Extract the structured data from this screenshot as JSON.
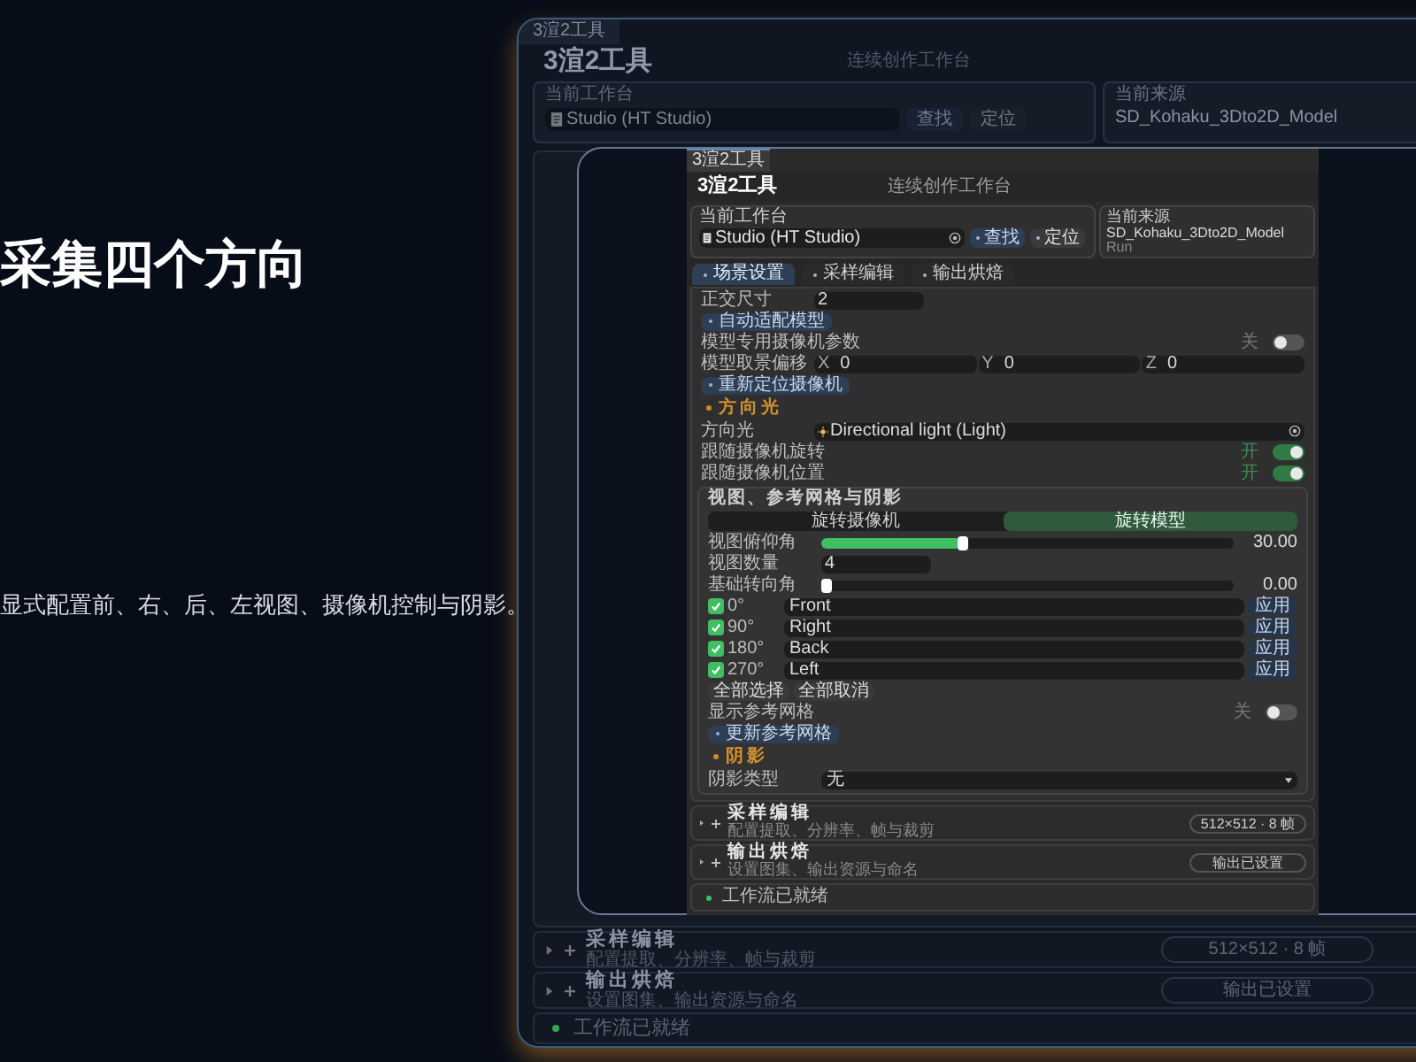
{
  "slide": {
    "heading": "采集四个方向",
    "description": "显式配置前、右、后、左视图、摄像机控制与阴影。"
  },
  "background_window": {
    "tab": "3渲2工具",
    "title": "3渲2工具",
    "subtitle": "连续创作工作台",
    "workspace_label": "当前工作台",
    "workspace_value": "Studio (HT Studio)",
    "find_button": "查找",
    "locate_button": "定位",
    "source_label": "当前来源",
    "source_value": "SD_Kohaku_3Dto2D_Model",
    "sections": [
      {
        "title": "采样编辑",
        "subtitle": "配置提取、分辨率、帧与裁剪",
        "badge": "512×512 · 8 帧"
      },
      {
        "title": "输出烘焙",
        "subtitle": "设置图集、输出资源与命名",
        "badge": "输出已设置"
      }
    ],
    "status": "工作流已就绪"
  },
  "window": {
    "tab": "3渲2工具",
    "title": "3渲2工具",
    "subtitle": "连续创作工作台",
    "workspace_label": "当前工作台",
    "workspace_value": "Studio (HT Studio)",
    "find_button": "查找",
    "locate_button": "定位",
    "source_label": "当前来源",
    "source_value": "SD_Kohaku_3Dto2D_Model",
    "source_note": "Run",
    "tabs": [
      {
        "label": "场景设置",
        "selected": true
      },
      {
        "label": "采样编辑",
        "selected": false
      },
      {
        "label": "输出烘焙",
        "selected": false
      }
    ],
    "scene_rows": [
      {
        "kind": "input",
        "label": "正交尺寸",
        "value": "2"
      },
      {
        "kind": "button",
        "label": "自动适配模型"
      },
      {
        "kind": "toggle",
        "label": "模型专用摄像机参数",
        "state_text": "关",
        "on": false
      },
      {
        "kind": "xyz",
        "label": "模型取景偏移",
        "axes": [
          {
            "axis": "X",
            "value": "0"
          },
          {
            "axis": "Y",
            "value": "0"
          },
          {
            "axis": "Z",
            "value": "0"
          }
        ]
      },
      {
        "kind": "button",
        "label": "重新定位摄像机"
      },
      {
        "kind": "section",
        "label": "方向光"
      },
      {
        "kind": "object",
        "label": "方向光",
        "value": "Directional light (Light)"
      },
      {
        "kind": "toggle",
        "label": "跟随摄像机旋转",
        "state_text": "开",
        "on": true
      },
      {
        "kind": "toggle",
        "label": "跟随摄像机位置",
        "state_text": "开",
        "on": true
      }
    ],
    "views_card": {
      "title": "视图、参考网格与阴影",
      "rows": [
        {
          "kind": "segmented",
          "options": [
            {
              "label": "旋转摄像机",
              "selected": false
            },
            {
              "label": "旋转模型",
              "selected": true
            }
          ]
        },
        {
          "kind": "slider",
          "label": "视图俯仰角",
          "level": 0.34,
          "reading": "30.00"
        },
        {
          "kind": "input",
          "label": "视图数量",
          "value": "4"
        },
        {
          "kind": "slider",
          "label": "基础转向角",
          "level": 0,
          "reading": "0.00"
        },
        {
          "kind": "view",
          "checked": true,
          "angle": "0°",
          "name": "Front",
          "button": "应用"
        },
        {
          "kind": "view",
          "checked": true,
          "angle": "90°",
          "name": "Right",
          "button": "应用"
        },
        {
          "kind": "view",
          "checked": true,
          "angle": "180°",
          "name": "Back",
          "button": "应用"
        },
        {
          "kind": "view",
          "checked": true,
          "angle": "270°",
          "name": "Left",
          "button": "应用"
        },
        {
          "kind": "buttons",
          "buttons": [
            "全部选择",
            "全部取消"
          ]
        },
        {
          "kind": "toggle",
          "label": "显示参考网格",
          "state_text": "关",
          "on": false
        },
        {
          "kind": "button",
          "label": "更新参考网格"
        },
        {
          "kind": "section",
          "label": "阴影"
        },
        {
          "kind": "select",
          "label": "阴影类型",
          "value": "无"
        }
      ]
    },
    "sections": [
      {
        "title": "采样编辑",
        "subtitle": "配置提取、分辨率、帧与裁剪",
        "badge": "512×512 · 8 帧"
      },
      {
        "title": "输出烘焙",
        "subtitle": "设置图集、输出资源与命名",
        "badge": "输出已设置"
      }
    ],
    "status": "工作流已就绪"
  }
}
